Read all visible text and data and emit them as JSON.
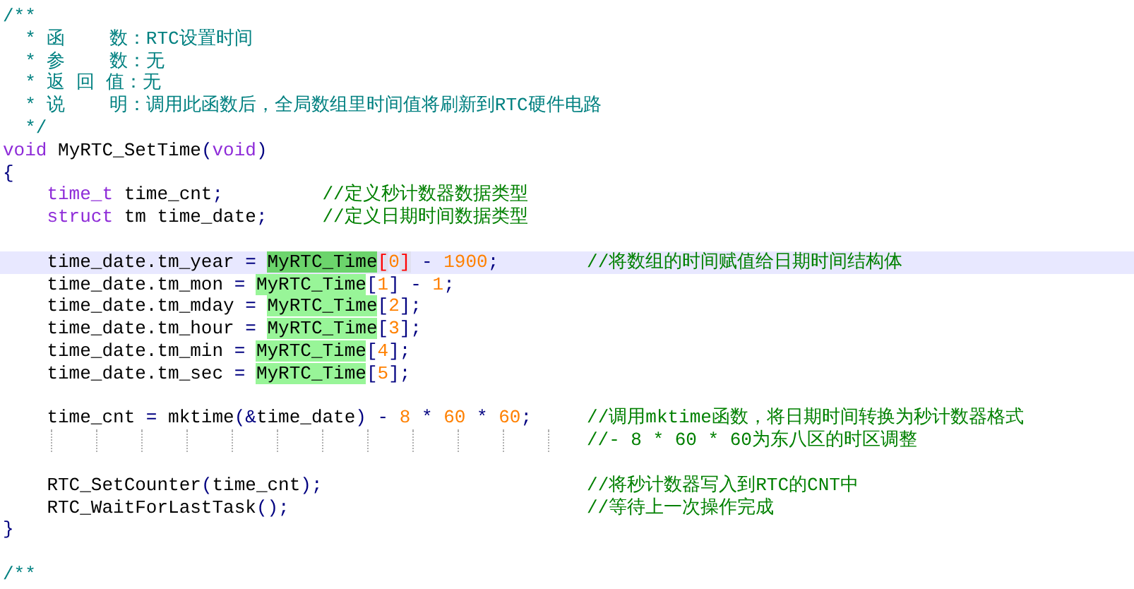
{
  "editor": {
    "lines": [
      {
        "kind": "code",
        "tokens": [
          {
            "kind": "doc",
            "text": "/**"
          }
        ]
      },
      {
        "kind": "code",
        "tokens": [
          {
            "kind": "doc",
            "text": "  * 函    数：RTC设置时间"
          }
        ]
      },
      {
        "kind": "code",
        "tokens": [
          {
            "kind": "doc",
            "text": "  * 参    数：无"
          }
        ]
      },
      {
        "kind": "code",
        "tokens": [
          {
            "kind": "doc",
            "text": "  * 返 回 值：无"
          }
        ]
      },
      {
        "kind": "code",
        "tokens": [
          {
            "kind": "doc",
            "text": "  * 说    明：调用此函数后，全局数组里时间值将刷新到RTC硬件电路"
          }
        ]
      },
      {
        "kind": "code",
        "tokens": [
          {
            "kind": "doc",
            "text": "  */"
          }
        ]
      },
      {
        "kind": "code",
        "tokens": [
          {
            "kind": "keyword",
            "text": "void"
          },
          {
            "kind": "code",
            "text": " MyRTC_SetTime"
          },
          {
            "kind": "op",
            "text": "("
          },
          {
            "kind": "keyword",
            "text": "void"
          },
          {
            "kind": "op",
            "text": ")"
          }
        ]
      },
      {
        "kind": "code",
        "tokens": [
          {
            "kind": "op",
            "text": "{"
          }
        ]
      },
      {
        "kind": "code",
        "tokens": [
          {
            "kind": "keyword",
            "text": "    time_t"
          },
          {
            "kind": "code",
            "text": " time_cnt"
          },
          {
            "kind": "op",
            "text": ";"
          },
          {
            "kind": "comment",
            "text": "         //定义秒计数器数据类型"
          }
        ]
      },
      {
        "kind": "code",
        "tokens": [
          {
            "kind": "keyword",
            "text": "    struct"
          },
          {
            "kind": "code",
            "text": " tm time_date"
          },
          {
            "kind": "op",
            "text": ";"
          },
          {
            "kind": "comment",
            "text": "     //定义日期时间数据类型"
          }
        ]
      },
      {
        "kind": "blank"
      },
      {
        "kind": "code",
        "current": true,
        "tokens": [
          {
            "kind": "code",
            "text": "    time_date.tm_year"
          },
          {
            "kind": "op",
            "text": " = "
          },
          {
            "kind": "match_selected",
            "text": "MyRTC_Time"
          },
          {
            "kind": "brace_match",
            "text": "["
          },
          {
            "kind": "number",
            "text": "0"
          },
          {
            "kind": "brace_match",
            "text": "]"
          },
          {
            "kind": "op",
            "text": " - "
          },
          {
            "kind": "number",
            "text": "1900"
          },
          {
            "kind": "op",
            "text": ";"
          },
          {
            "kind": "comment",
            "text": "        //将数组的时间赋值给日期时间结构体"
          }
        ]
      },
      {
        "kind": "code",
        "tokens": [
          {
            "kind": "code",
            "text": "    time_date.tm_mon"
          },
          {
            "kind": "op",
            "text": " = "
          },
          {
            "kind": "match",
            "text": "MyRTC_Time"
          },
          {
            "kind": "op",
            "text": "["
          },
          {
            "kind": "number",
            "text": "1"
          },
          {
            "kind": "op",
            "text": "] - "
          },
          {
            "kind": "number",
            "text": "1"
          },
          {
            "kind": "op",
            "text": ";"
          }
        ]
      },
      {
        "kind": "code",
        "tokens": [
          {
            "kind": "code",
            "text": "    time_date.tm_mday"
          },
          {
            "kind": "op",
            "text": " = "
          },
          {
            "kind": "match",
            "text": "MyRTC_Time"
          },
          {
            "kind": "op",
            "text": "["
          },
          {
            "kind": "number",
            "text": "2"
          },
          {
            "kind": "op",
            "text": "];"
          }
        ]
      },
      {
        "kind": "code",
        "tokens": [
          {
            "kind": "code",
            "text": "    time_date.tm_hour"
          },
          {
            "kind": "op",
            "text": " = "
          },
          {
            "kind": "match",
            "text": "MyRTC_Time"
          },
          {
            "kind": "op",
            "text": "["
          },
          {
            "kind": "number",
            "text": "3"
          },
          {
            "kind": "op",
            "text": "];"
          }
        ]
      },
      {
        "kind": "code",
        "tokens": [
          {
            "kind": "code",
            "text": "    time_date.tm_min"
          },
          {
            "kind": "op",
            "text": " = "
          },
          {
            "kind": "match",
            "text": "MyRTC_Time"
          },
          {
            "kind": "op",
            "text": "["
          },
          {
            "kind": "number",
            "text": "4"
          },
          {
            "kind": "op",
            "text": "];"
          }
        ]
      },
      {
        "kind": "code",
        "tokens": [
          {
            "kind": "code",
            "text": "    time_date.tm_sec"
          },
          {
            "kind": "op",
            "text": " = "
          },
          {
            "kind": "match",
            "text": "MyRTC_Time"
          },
          {
            "kind": "op",
            "text": "["
          },
          {
            "kind": "number",
            "text": "5"
          },
          {
            "kind": "op",
            "text": "];"
          }
        ]
      },
      {
        "kind": "blank"
      },
      {
        "kind": "code",
        "tokens": [
          {
            "kind": "code",
            "text": "    time_cnt"
          },
          {
            "kind": "op",
            "text": " = "
          },
          {
            "kind": "code",
            "text": "mktime"
          },
          {
            "kind": "op",
            "text": "(&"
          },
          {
            "kind": "code",
            "text": "time_date"
          },
          {
            "kind": "op",
            "text": ") - "
          },
          {
            "kind": "number",
            "text": "8"
          },
          {
            "kind": "op",
            "text": " * "
          },
          {
            "kind": "number",
            "text": "60"
          },
          {
            "kind": "op",
            "text": " * "
          },
          {
            "kind": "number",
            "text": "60"
          },
          {
            "kind": "op",
            "text": ";"
          },
          {
            "kind": "comment",
            "text": "     //调用mktime函数，将日期时间转换为秒计数器格式"
          }
        ]
      },
      {
        "kind": "code",
        "indent_guides": true,
        "tokens": [
          {
            "kind": "comment",
            "text": "                                                     //- 8 * 60 * 60为东八区的时区调整"
          }
        ]
      },
      {
        "kind": "blank"
      },
      {
        "kind": "code",
        "tokens": [
          {
            "kind": "code",
            "text": "    RTC_SetCounter"
          },
          {
            "kind": "op",
            "text": "("
          },
          {
            "kind": "code",
            "text": "time_cnt"
          },
          {
            "kind": "op",
            "text": ");"
          },
          {
            "kind": "comment",
            "text": "                        //将秒计数器写入到RTC的CNT中"
          }
        ]
      },
      {
        "kind": "code",
        "tokens": [
          {
            "kind": "code",
            "text": "    RTC_WaitForLastTask"
          },
          {
            "kind": "op",
            "text": "();"
          },
          {
            "kind": "comment",
            "text": "                           //等待上一次操作完成"
          }
        ]
      },
      {
        "kind": "code",
        "tokens": [
          {
            "kind": "op",
            "text": "}"
          }
        ]
      },
      {
        "kind": "blank"
      },
      {
        "kind": "code",
        "tokens": [
          {
            "kind": "doc",
            "text": "/**"
          }
        ]
      }
    ]
  }
}
